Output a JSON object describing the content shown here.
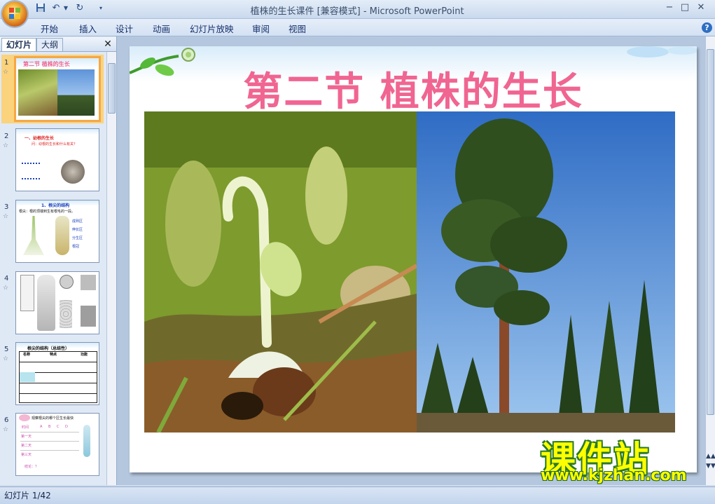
{
  "window": {
    "title": "植株的生长课件 [兼容模式] - Microsoft PowerPoint",
    "controls": [
      "−",
      "□",
      "✕"
    ]
  },
  "quick_access": {
    "icons": [
      "save-icon",
      "undo-icon",
      "redo-icon",
      "customize-icon"
    ]
  },
  "ribbon": {
    "tabs": [
      "开始",
      "插入",
      "设计",
      "动画",
      "幻灯片放映",
      "审阅",
      "视图"
    ]
  },
  "panel": {
    "tabs": {
      "slides": "幻灯片",
      "outline": "大纲"
    },
    "close": "✕",
    "thumbnails": [
      {
        "num": "1",
        "title": "第二节  植株的生长"
      },
      {
        "num": "2",
        "title": "一、幼根的生长",
        "subtitle": "问：幼根的生长和什么有关？"
      },
      {
        "num": "3",
        "title": "1、根尖的结构",
        "subtitle": "根尖：根的顶端到生有根毛的一段。",
        "labels": [
          "成熟区",
          "伸长区",
          "分生区",
          "根冠"
        ]
      },
      {
        "num": "4",
        "title": ""
      },
      {
        "num": "5",
        "title": "根尖的结构（总结性）",
        "headers": [
          "名称",
          "特点",
          "功能"
        ]
      },
      {
        "num": "6",
        "title": "观察根尖的哪个区生长最快",
        "headers": [
          "时间",
          "A",
          "B",
          "C",
          "D"
        ],
        "rows": [
          "第一天",
          "第二天",
          "第三天"
        ],
        "footer": "结论：？"
      }
    ]
  },
  "slide": {
    "title": "第二节    植株的生长"
  },
  "watermark": {
    "brand": "课件站",
    "url": "www.kjzhan.com"
  },
  "status": {
    "text": "幻灯片 1/42"
  }
}
